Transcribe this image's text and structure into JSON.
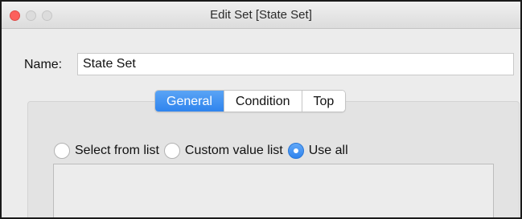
{
  "window": {
    "title": "Edit Set [State Set]",
    "controls": [
      "close",
      "minimize",
      "zoom"
    ]
  },
  "name": {
    "label": "Name:",
    "value": "State Set"
  },
  "tabs": [
    {
      "label": "General",
      "active": true
    },
    {
      "label": "Condition",
      "active": false
    },
    {
      "label": "Top",
      "active": false
    }
  ],
  "options": [
    {
      "label": "Select from list",
      "checked": false
    },
    {
      "label": "Custom value list",
      "checked": false
    },
    {
      "label": "Use all",
      "checked": true
    }
  ],
  "colors": {
    "accent": "#2f84ee",
    "close": "#fc605c"
  }
}
